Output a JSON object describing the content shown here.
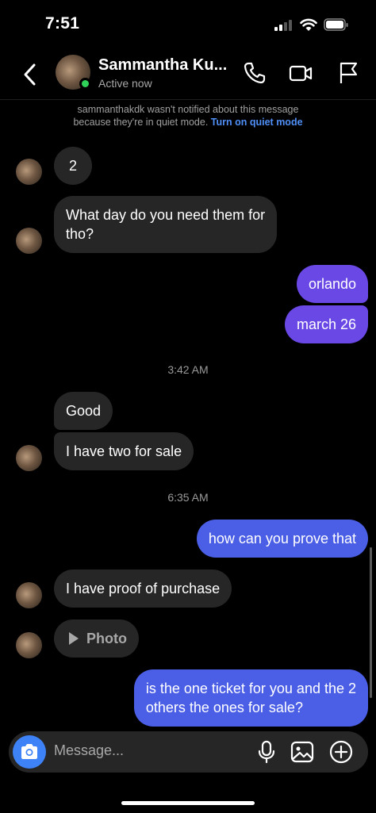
{
  "status_bar": {
    "time": "7:51"
  },
  "header": {
    "contact_name": "Sammantha Ku...",
    "status": "Active now"
  },
  "notice": {
    "text": "sammanthakdk wasn't notified about this message",
    "text2": "because they're in quiet mode.",
    "link": "Turn on quiet mode"
  },
  "messages": [
    {
      "from": "them",
      "text": "2"
    },
    {
      "from": "them",
      "line1": "What day do you need them for",
      "line2": "tho?"
    },
    {
      "from": "me",
      "text": "orlando"
    },
    {
      "from": "me",
      "text": "march 26"
    },
    {
      "type": "timestamp",
      "text": "3:42 AM"
    },
    {
      "from": "them",
      "text": "Good"
    },
    {
      "from": "them",
      "text": "I have two for sale"
    },
    {
      "type": "timestamp",
      "text": "6:35 AM"
    },
    {
      "from": "me",
      "text": "how can you prove that"
    },
    {
      "from": "them",
      "text": "I have proof of purchase"
    },
    {
      "from": "them",
      "type": "photo",
      "text": "Photo"
    },
    {
      "from": "me",
      "line1": "is the one ticket for you and the 2",
      "line2": "others the ones for sale?"
    }
  ],
  "composer": {
    "placeholder": "Message..."
  },
  "colors": {
    "outgoing": "#6a48e6",
    "outgoing_blue": "#4a5ee6",
    "incoming": "#262626",
    "link": "#4f8ff7",
    "online": "#2fd158"
  }
}
